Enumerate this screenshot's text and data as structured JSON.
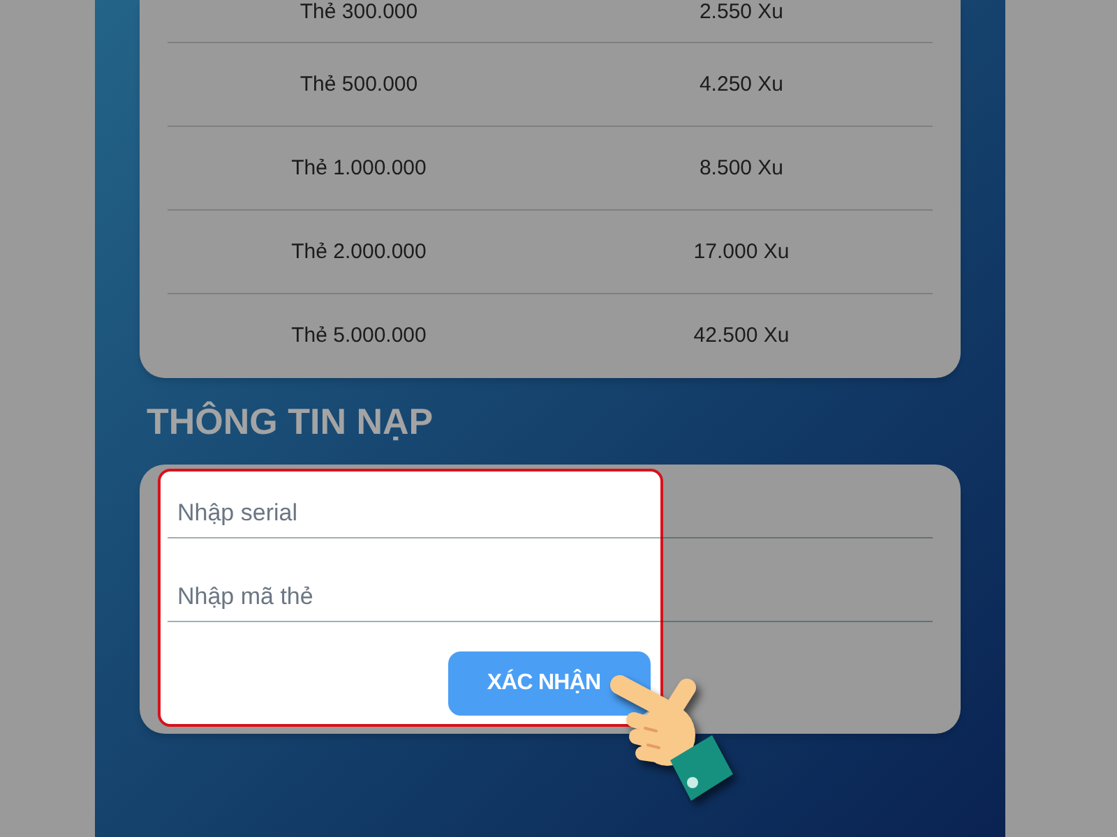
{
  "rate_table": {
    "rows": [
      {
        "cells": [
          "Thẻ 300.000",
          "2.550 Xu"
        ]
      },
      {
        "cells": [
          "Thẻ 500.000",
          "4.250 Xu"
        ]
      },
      {
        "cells": [
          "Thẻ 1.000.000",
          "8.500 Xu"
        ]
      },
      {
        "cells": [
          "Thẻ 2.000.000",
          "17.000 Xu"
        ]
      },
      {
        "cells": [
          "Thẻ 5.000.000",
          "42.500 Xu"
        ]
      }
    ]
  },
  "section_title": "THÔNG TIN NẠP",
  "form": {
    "fields": [
      {
        "placeholder": "Nhập serial"
      },
      {
        "placeholder": "Nhập mã thẻ"
      }
    ],
    "submit_button": "XÁC NHẬN",
    "highlighted": true
  }
}
